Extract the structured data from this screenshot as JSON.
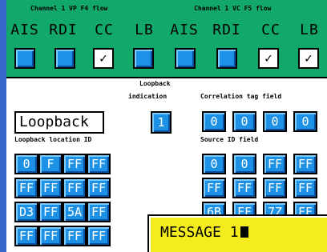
{
  "header": {
    "vp_title": "Channel 1 VP F4 flow",
    "vc_title": "Channel 1 VC F5 flow",
    "labels": [
      "AIS",
      "RDI",
      "CC",
      "LB",
      "AIS",
      "RDI",
      "CC",
      "LB"
    ],
    "checks": [
      false,
      false,
      true,
      false,
      false,
      false,
      true,
      true
    ]
  },
  "loopback": {
    "value": "Loopback",
    "indication_label": "Loopback indication",
    "indication_value": "1",
    "location_label": "Loopback location ID",
    "location_cells": [
      [
        "0",
        "F",
        "FF",
        "FF"
      ],
      [
        "FF",
        "FF",
        "FF",
        "FF"
      ],
      [
        "D3",
        "FF",
        "5A",
        "FF"
      ],
      [
        "FF",
        "FF",
        "FF",
        "FF"
      ]
    ]
  },
  "correlation": {
    "label": "Correlation tag field",
    "cells": [
      "0",
      "0",
      "0",
      "0"
    ]
  },
  "source": {
    "label": "Source ID field",
    "cells": [
      [
        "0",
        "0",
        "FF",
        "FF"
      ],
      [
        "FF",
        "FF",
        "FF",
        "FF"
      ],
      [
        "6B",
        "FF",
        "7Z",
        "FF"
      ]
    ]
  },
  "message": {
    "text": "MESSAGE 1"
  },
  "colors": {
    "accent": "#1d91e6",
    "header": "#13a86b",
    "message": "#f4ec1c"
  },
  "icons": {
    "check": "check-icon"
  }
}
